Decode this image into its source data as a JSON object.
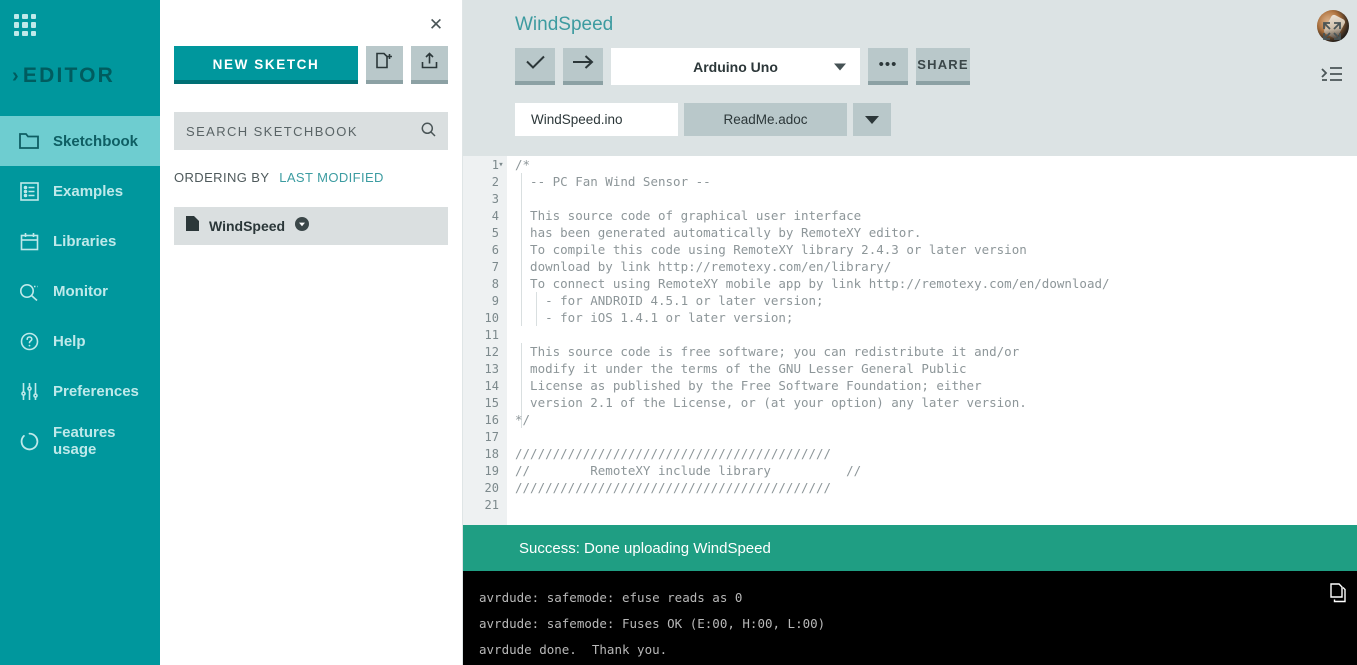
{
  "nav": {
    "apps_icon": "apps-grid-icon",
    "brand": "EDITOR",
    "items": [
      {
        "label": "Sketchbook",
        "icon": "folder-icon",
        "active": true
      },
      {
        "label": "Examples",
        "icon": "list-icon",
        "active": false
      },
      {
        "label": "Libraries",
        "icon": "library-icon",
        "active": false
      },
      {
        "label": "Monitor",
        "icon": "monitor-search-icon",
        "active": false
      },
      {
        "label": "Help",
        "icon": "question-circle-icon",
        "active": false
      },
      {
        "label": "Preferences",
        "icon": "sliders-icon",
        "active": false
      },
      {
        "label": "Features usage",
        "icon": "circle-dash-icon",
        "active": false
      }
    ]
  },
  "panel": {
    "close_icon": "close-icon",
    "new_sketch_label": "NEW SKETCH",
    "new_file_icon": "new-file-icon",
    "import_icon": "upload-icon",
    "search_placeholder": "SEARCH SKETCHBOOK",
    "search_icon": "search-icon",
    "ordering_label": "ORDERING BY",
    "ordering_value": "LAST MODIFIED",
    "sketches": [
      {
        "name": "WindSpeed",
        "file_icon": "sketch-file-icon",
        "menu_icon": "chevron-down-circle-icon"
      }
    ]
  },
  "editor": {
    "title": "WindSpeed",
    "toolbar": {
      "verify_icon": "checkmark-icon",
      "upload_icon": "arrow-right-icon",
      "board": "Arduino Uno",
      "board_caret_icon": "chevron-down-icon",
      "more_label": "•••",
      "share_label": "SHARE"
    },
    "tabs": [
      {
        "label": "WindSpeed.ino",
        "active": true
      },
      {
        "label": "ReadMe.adoc",
        "active": false
      }
    ],
    "tabs_more_icon": "chevron-down-icon",
    "side_icons": [
      "fullscreen-expand-icon",
      "format-indent-icon"
    ],
    "avatar": "user-avatar",
    "code_lines": [
      {
        "n": "1",
        "text": "/*",
        "fold": "▾"
      },
      {
        "n": "2",
        "text": "  -- PC Fan Wind Sensor --"
      },
      {
        "n": "3",
        "text": ""
      },
      {
        "n": "4",
        "text": "  This source code of graphical user interface"
      },
      {
        "n": "5",
        "text": "  has been generated automatically by RemoteXY editor."
      },
      {
        "n": "6",
        "text": "  To compile this code using RemoteXY library 2.4.3 or later version"
      },
      {
        "n": "7",
        "text": "  download by link http://remotexy.com/en/library/"
      },
      {
        "n": "8",
        "text": "  To connect using RemoteXY mobile app by link http://remotexy.com/en/download/"
      },
      {
        "n": "9",
        "text": "    - for ANDROID 4.5.1 or later version;"
      },
      {
        "n": "10",
        "text": "    - for iOS 1.4.1 or later version;"
      },
      {
        "n": "11",
        "text": ""
      },
      {
        "n": "12",
        "text": "  This source code is free software; you can redistribute it and/or"
      },
      {
        "n": "13",
        "text": "  modify it under the terms of the GNU Lesser General Public"
      },
      {
        "n": "14",
        "text": "  License as published by the Free Software Foundation; either"
      },
      {
        "n": "15",
        "text": "  version 2.1 of the License, or (at your option) any later version."
      },
      {
        "n": "16",
        "text": "*/"
      },
      {
        "n": "17",
        "text": ""
      },
      {
        "n": "18",
        "text": "//////////////////////////////////////////"
      },
      {
        "n": "19",
        "text": "//        RemoteXY include library          //"
      },
      {
        "n": "20",
        "text": "//////////////////////////////////////////"
      },
      {
        "n": "21",
        "text": ""
      }
    ]
  },
  "console": {
    "status": "Success: Done uploading WindSpeed",
    "status_color": "#1f9e83",
    "copy_icon": "copy-icon",
    "lines": [
      "avrdude: safemode: efuse reads as 0",
      "avrdude: safemode: Fuses OK (E:00, H:00, L:00)",
      "avrdude done.  Thank you."
    ]
  }
}
